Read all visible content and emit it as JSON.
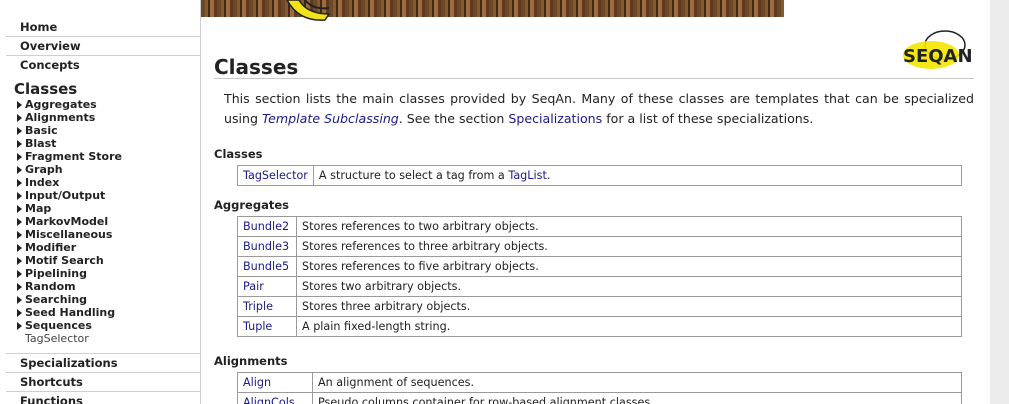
{
  "sidebar": {
    "top": [
      {
        "label": "Home"
      },
      {
        "label": "Overview"
      },
      {
        "label": "Concepts"
      }
    ],
    "classes_label": "Classes",
    "class_groups": [
      {
        "label": "Aggregates"
      },
      {
        "label": "Alignments"
      },
      {
        "label": "Basic"
      },
      {
        "label": "Blast"
      },
      {
        "label": "Fragment Store"
      },
      {
        "label": "Graph"
      },
      {
        "label": "Index"
      },
      {
        "label": "Input/Output"
      },
      {
        "label": "Map"
      },
      {
        "label": "MarkovModel"
      },
      {
        "label": "Miscellaneous"
      },
      {
        "label": "Modifier"
      },
      {
        "label": "Motif Search"
      },
      {
        "label": "Pipelining"
      },
      {
        "label": "Random"
      },
      {
        "label": "Searching"
      },
      {
        "label": "Seed Handling"
      },
      {
        "label": "Sequences"
      }
    ],
    "leaf": "TagSelector",
    "bottom": [
      {
        "label": "Specializations"
      },
      {
        "label": "Shortcuts"
      },
      {
        "label": "Functions"
      }
    ]
  },
  "main": {
    "logo_text": "SEQAN",
    "title": "Classes",
    "intro": {
      "part1": "This section lists the main classes provided by SeqAn. Many of these classes are templates that can be specialized using ",
      "link1": "Template Subclassing",
      "part2": ". See the section ",
      "link2": "Specializations",
      "part3": " for a list of these specializations."
    },
    "sections": [
      {
        "heading": "Classes",
        "rows": [
          {
            "name": "TagSelector",
            "desc": "A structure to select a tag from a ",
            "desc_link": "TagList",
            "desc_end": "."
          }
        ]
      },
      {
        "heading": "Aggregates",
        "rows": [
          {
            "name": "Bundle2",
            "desc": "Stores references to two arbitrary objects."
          },
          {
            "name": "Bundle3",
            "desc": "Stores references to three arbitrary objects."
          },
          {
            "name": "Bundle5",
            "desc": "Stores references to five arbitrary objects."
          },
          {
            "name": "Pair",
            "desc": "Stores two arbitrary objects."
          },
          {
            "name": "Triple",
            "desc": "Stores three arbitrary objects."
          },
          {
            "name": "Tuple",
            "desc": "A plain fixed-length string."
          }
        ]
      },
      {
        "heading": "Alignments",
        "rows": [
          {
            "name": "Align",
            "desc": "An alignment of sequences."
          },
          {
            "name": "AlignCols",
            "desc": "Pseudo columns container for row-based alignment classes."
          }
        ]
      }
    ]
  }
}
